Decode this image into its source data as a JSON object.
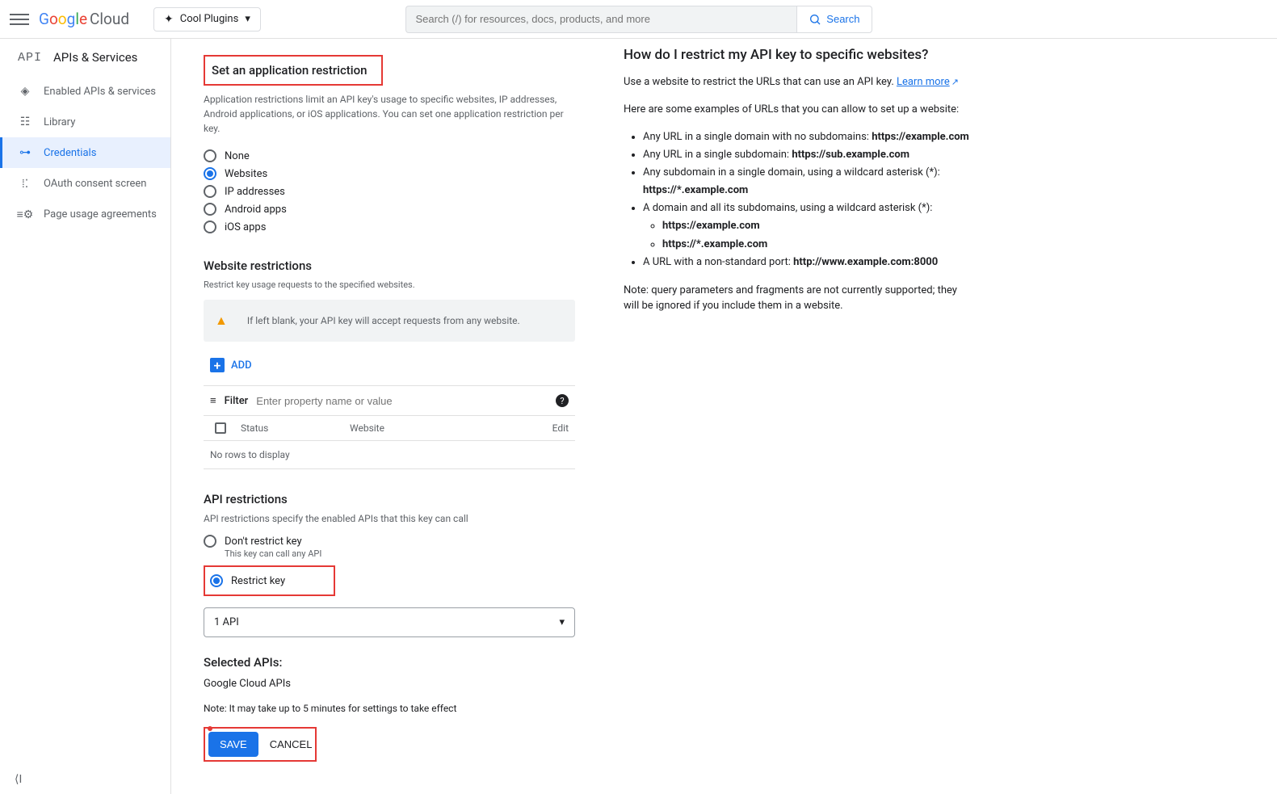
{
  "header": {
    "logo_cloud": "Cloud",
    "project": "Cool Plugins",
    "search_placeholder": "Search (/) for resources, docs, products, and more",
    "search_button": "Search"
  },
  "sidebar": {
    "title": "APIs & Services",
    "api_label": "API",
    "items": [
      {
        "label": "Enabled APIs & services"
      },
      {
        "label": "Library"
      },
      {
        "label": "Credentials"
      },
      {
        "label": "OAuth consent screen"
      },
      {
        "label": "Page usage agreements"
      }
    ]
  },
  "app_restriction": {
    "title": "Set an application restriction",
    "desc": "Application restrictions limit an API key's usage to specific websites, IP addresses, Android applications, or iOS applications. You can set one application restriction per key.",
    "options": [
      "None",
      "Websites",
      "IP addresses",
      "Android apps",
      "iOS apps"
    ],
    "selected": "Websites"
  },
  "web_restrictions": {
    "title": "Website restrictions",
    "desc": "Restrict key usage requests to the specified websites.",
    "warn": "If left blank, your API key will accept requests from any website.",
    "add": "ADD",
    "filter_label": "Filter",
    "filter_placeholder": "Enter property name or value",
    "th_status": "Status",
    "th_website": "Website",
    "th_edit": "Edit",
    "no_rows": "No rows to display"
  },
  "api_restrictions": {
    "title": "API restrictions",
    "desc": "API restrictions specify the enabled APIs that this key can call",
    "opt_dont": "Don't restrict key",
    "opt_dont_sub": "This key can call any API",
    "opt_restrict": "Restrict key",
    "picker_value": "1 API",
    "selected_title": "Selected APIs:",
    "selected_apis": "Google Cloud APIs",
    "note": "Note: It may take up to 5 minutes for settings to take effect",
    "save": "SAVE",
    "cancel": "CANCEL"
  },
  "help": {
    "title": "How do I restrict my API key to specific websites?",
    "intro_pre": "Use a website to restrict the URLs that can use an API key. ",
    "learn_more": "Learn more",
    "examples_intro": "Here are some examples of URLs that you can allow to set up a website:",
    "ex1_pre": "Any URL in a single domain with no subdomains: ",
    "ex1_b": "https://example.com",
    "ex2_pre": "Any URL in a single subdomain: ",
    "ex2_b": "https://sub.example.com",
    "ex3_line": "Any subdomain in a single domain, using a wildcard asterisk (*):",
    "ex3_b": "https://*.example.com",
    "ex4_line": "A domain and all its subdomains, using a wildcard asterisk (*):",
    "ex4_sub1": "https://example.com",
    "ex4_sub2": "https://*.example.com",
    "ex5_pre": "A URL with a non-standard port: ",
    "ex5_b": "http://www.example.com:8000",
    "note": "Note: query parameters and fragments are not currently supported; they will be ignored if you include them in a website."
  }
}
